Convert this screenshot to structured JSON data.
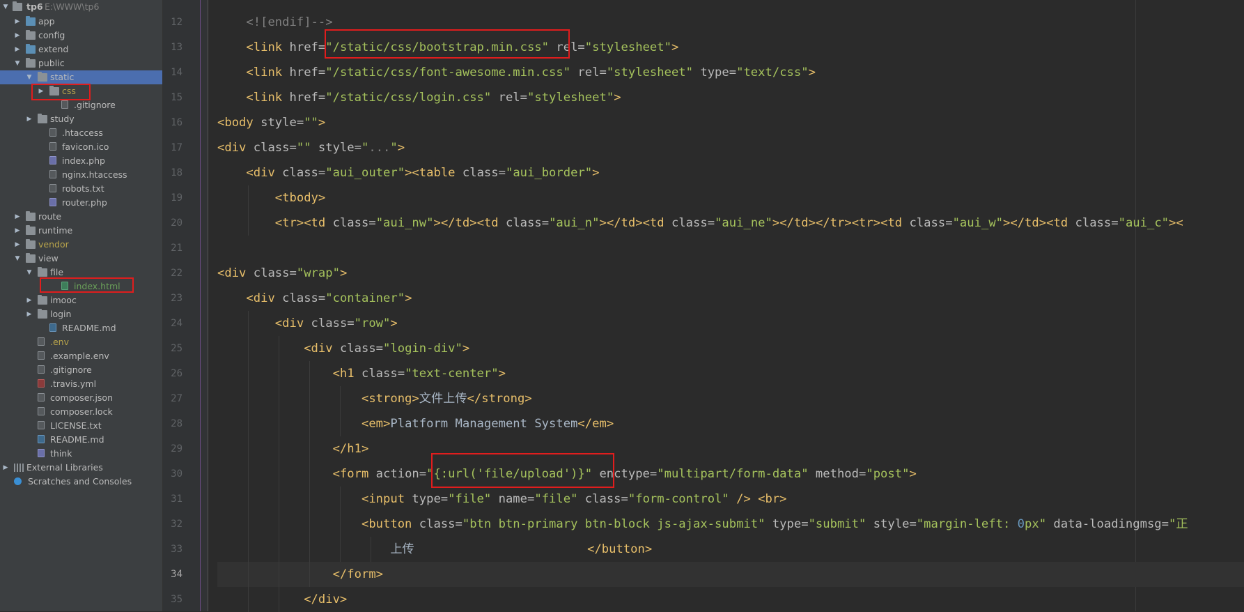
{
  "project": {
    "root": {
      "name": "tp6",
      "path": "E:\\WWW\\tp6"
    },
    "tree": [
      {
        "label": "app",
        "kind": "folder",
        "depth": 1,
        "arrow": "collapsed",
        "color": "blue"
      },
      {
        "label": "config",
        "kind": "folder",
        "depth": 1,
        "arrow": "collapsed"
      },
      {
        "label": "extend",
        "kind": "folder",
        "depth": 1,
        "arrow": "collapsed",
        "color": "blue"
      },
      {
        "label": "public",
        "kind": "folder",
        "depth": 1,
        "arrow": "expanded"
      },
      {
        "label": "static",
        "kind": "folder",
        "depth": 2,
        "arrow": "expanded",
        "selected": true
      },
      {
        "label": "css",
        "kind": "folder",
        "depth": 3,
        "arrow": "collapsed",
        "labelColor": "gold",
        "boxed": true
      },
      {
        "label": ".gitignore",
        "kind": "file",
        "depth": 4,
        "ftype": "cfg"
      },
      {
        "label": "study",
        "kind": "folder",
        "depth": 2,
        "arrow": "collapsed"
      },
      {
        "label": ".htaccess",
        "kind": "file",
        "depth": 3,
        "ftype": "cfg"
      },
      {
        "label": "favicon.ico",
        "kind": "file",
        "depth": 3,
        "ftype": "cfg"
      },
      {
        "label": "index.php",
        "kind": "file",
        "depth": 3,
        "ftype": "php"
      },
      {
        "label": "nginx.htaccess",
        "kind": "file",
        "depth": 3,
        "ftype": "cfg"
      },
      {
        "label": "robots.txt",
        "kind": "file",
        "depth": 3,
        "ftype": "cfg"
      },
      {
        "label": "router.php",
        "kind": "file",
        "depth": 3,
        "ftype": "php"
      },
      {
        "label": "route",
        "kind": "folder",
        "depth": 1,
        "arrow": "collapsed"
      },
      {
        "label": "runtime",
        "kind": "folder",
        "depth": 1,
        "arrow": "collapsed"
      },
      {
        "label": "vendor",
        "kind": "folder",
        "depth": 1,
        "arrow": "collapsed",
        "labelColor": "gold"
      },
      {
        "label": "view",
        "kind": "folder",
        "depth": 1,
        "arrow": "expanded"
      },
      {
        "label": "file",
        "kind": "folder",
        "depth": 2,
        "arrow": "expanded"
      },
      {
        "label": "index.html",
        "kind": "file",
        "depth": 4,
        "ftype": "html",
        "labelColor": "green",
        "boxed": true
      },
      {
        "label": "imooc",
        "kind": "folder",
        "depth": 2,
        "arrow": "collapsed"
      },
      {
        "label": "login",
        "kind": "folder",
        "depth": 2,
        "arrow": "collapsed"
      },
      {
        "label": "README.md",
        "kind": "file",
        "depth": 3,
        "ftype": "md"
      },
      {
        "label": ".env",
        "kind": "file",
        "depth": 2,
        "ftype": "cfg",
        "labelColor": "gold"
      },
      {
        "label": ".example.env",
        "kind": "file",
        "depth": 2,
        "ftype": "cfg"
      },
      {
        "label": ".gitignore",
        "kind": "file",
        "depth": 2,
        "ftype": "cfg"
      },
      {
        "label": ".travis.yml",
        "kind": "file",
        "depth": 2,
        "ftype": "yml"
      },
      {
        "label": "composer.json",
        "kind": "file",
        "depth": 2,
        "ftype": "cfg"
      },
      {
        "label": "composer.lock",
        "kind": "file",
        "depth": 2,
        "ftype": "cfg"
      },
      {
        "label": "LICENSE.txt",
        "kind": "file",
        "depth": 2,
        "ftype": "cfg"
      },
      {
        "label": "README.md",
        "kind": "file",
        "depth": 2,
        "ftype": "md"
      },
      {
        "label": "think",
        "kind": "file",
        "depth": 2,
        "ftype": "php"
      },
      {
        "label": "External Libraries",
        "kind": "lib",
        "depth": 0,
        "arrow": "collapsed"
      },
      {
        "label": "Scratches and Consoles",
        "kind": "scratch",
        "depth": 0
      }
    ]
  },
  "editor": {
    "current_line": 34,
    "lines": [
      {
        "n": "12",
        "tokens": [
          [
            "cm",
            "<![endif]-->"
          ]
        ],
        "indent": 1
      },
      {
        "n": "13",
        "tokens": [
          [
            "tg",
            "<link "
          ],
          [
            "at",
            "href="
          ],
          [
            "vl",
            "\"/static/css/bootstrap.min.css\""
          ],
          [
            "at",
            " rel="
          ],
          [
            "vl",
            "\"stylesheet\""
          ],
          [
            "tg",
            ">"
          ]
        ],
        "indent": 1
      },
      {
        "n": "14",
        "tokens": [
          [
            "tg",
            "<link "
          ],
          [
            "at",
            "href="
          ],
          [
            "vl",
            "\"/static/css/font-awesome.min.css\""
          ],
          [
            "at",
            " rel="
          ],
          [
            "vl",
            "\"stylesheet\""
          ],
          [
            "at",
            " type="
          ],
          [
            "vl",
            "\"text/css\""
          ],
          [
            "tg",
            ">"
          ]
        ],
        "indent": 1
      },
      {
        "n": "15",
        "tokens": [
          [
            "tg",
            "<link "
          ],
          [
            "at",
            "href="
          ],
          [
            "vl",
            "\"/static/css/login.css\""
          ],
          [
            "at",
            " rel="
          ],
          [
            "vl",
            "\"stylesheet\""
          ],
          [
            "tg",
            ">"
          ]
        ],
        "indent": 1
      },
      {
        "n": "16",
        "tokens": [
          [
            "tg",
            "<body "
          ],
          [
            "at",
            "style="
          ],
          [
            "vl",
            "\"\""
          ],
          [
            "tg",
            ">"
          ]
        ],
        "indent": 0
      },
      {
        "n": "17",
        "tokens": [
          [
            "tg",
            "<div "
          ],
          [
            "at",
            "class="
          ],
          [
            "vl",
            "\"\""
          ],
          [
            "at",
            " style="
          ],
          [
            "vl",
            "\""
          ],
          [
            "cm",
            "..."
          ],
          [
            "vl",
            "\""
          ],
          [
            "tg",
            ">"
          ]
        ],
        "indent": 0
      },
      {
        "n": "18",
        "tokens": [
          [
            "tg",
            "<div "
          ],
          [
            "at",
            "class="
          ],
          [
            "vl",
            "\"aui_outer\""
          ],
          [
            "tg",
            "><table "
          ],
          [
            "at",
            "class="
          ],
          [
            "vl",
            "\"aui_border\""
          ],
          [
            "tg",
            ">"
          ]
        ],
        "indent": 1
      },
      {
        "n": "19",
        "tokens": [
          [
            "tg",
            "<tbody>"
          ]
        ],
        "indent": 2
      },
      {
        "n": "20",
        "tokens": [
          [
            "tg",
            "<tr><td "
          ],
          [
            "at",
            "class="
          ],
          [
            "vl",
            "\"aui_nw\""
          ],
          [
            "tg",
            "></td><td "
          ],
          [
            "at",
            "class="
          ],
          [
            "vl",
            "\"aui_n\""
          ],
          [
            "tg",
            "></td><td "
          ],
          [
            "at",
            "class="
          ],
          [
            "vl",
            "\"aui_ne\""
          ],
          [
            "tg",
            "></td></tr><tr><td "
          ],
          [
            "at",
            "class="
          ],
          [
            "vl",
            "\"aui_w\""
          ],
          [
            "tg",
            "></td><td "
          ],
          [
            "at",
            "class="
          ],
          [
            "vl",
            "\"aui_c\""
          ],
          [
            "tg",
            "><"
          ]
        ],
        "indent": 2
      },
      {
        "n": "21",
        "tokens": [],
        "indent": 0
      },
      {
        "n": "22",
        "tokens": [
          [
            "tg",
            "<div "
          ],
          [
            "at",
            "class="
          ],
          [
            "vl",
            "\"wrap\""
          ],
          [
            "tg",
            ">"
          ]
        ],
        "indent": 0
      },
      {
        "n": "23",
        "tokens": [
          [
            "tg",
            "<div "
          ],
          [
            "at",
            "class="
          ],
          [
            "vl",
            "\"container\""
          ],
          [
            "tg",
            ">"
          ]
        ],
        "indent": 1
      },
      {
        "n": "24",
        "tokens": [
          [
            "tg",
            "<div "
          ],
          [
            "at",
            "class="
          ],
          [
            "vl",
            "\"row\""
          ],
          [
            "tg",
            ">"
          ]
        ],
        "indent": 2
      },
      {
        "n": "25",
        "tokens": [
          [
            "tg",
            "<div "
          ],
          [
            "at",
            "class="
          ],
          [
            "vl",
            "\"login-div\""
          ],
          [
            "tg",
            ">"
          ]
        ],
        "indent": 3
      },
      {
        "n": "26",
        "tokens": [
          [
            "tg",
            "<h1 "
          ],
          [
            "at",
            "class="
          ],
          [
            "vl",
            "\"text-center\""
          ],
          [
            "tg",
            ">"
          ]
        ],
        "indent": 4
      },
      {
        "n": "27",
        "tokens": [
          [
            "tg",
            "<strong>"
          ],
          [
            "tx",
            "文件上传"
          ],
          [
            "tg",
            "</strong>"
          ]
        ],
        "indent": 5
      },
      {
        "n": "28",
        "tokens": [
          [
            "tg",
            "<em>"
          ],
          [
            "tx",
            "Platform Management System"
          ],
          [
            "tg",
            "</em>"
          ]
        ],
        "indent": 5
      },
      {
        "n": "29",
        "tokens": [
          [
            "tg",
            "</h1>"
          ]
        ],
        "indent": 4
      },
      {
        "n": "30",
        "tokens": [
          [
            "tg",
            "<form "
          ],
          [
            "at",
            "action="
          ],
          [
            "vl",
            "\"{:url('file/upload')}\""
          ],
          [
            "at",
            " enctype="
          ],
          [
            "vl",
            "\"multipart/form-data\""
          ],
          [
            "at",
            " method="
          ],
          [
            "vl",
            "\"post\""
          ],
          [
            "tg",
            ">"
          ]
        ],
        "indent": 4
      },
      {
        "n": "31",
        "tokens": [
          [
            "tg",
            "<input "
          ],
          [
            "at",
            "type="
          ],
          [
            "vl",
            "\"file\""
          ],
          [
            "at",
            " name="
          ],
          [
            "vl",
            "\"file\""
          ],
          [
            "at",
            " class="
          ],
          [
            "vl",
            "\"form-control\""
          ],
          [
            "tg",
            " /> <br>"
          ]
        ],
        "indent": 5
      },
      {
        "n": "32",
        "tokens": [
          [
            "tg",
            "<button "
          ],
          [
            "at",
            "class="
          ],
          [
            "vl",
            "\"btn btn-primary btn-block js-ajax-submit\""
          ],
          [
            "at",
            " type="
          ],
          [
            "vl",
            "\"submit\""
          ],
          [
            "at",
            " style="
          ],
          [
            "vl",
            "\"margin-left: "
          ],
          [
            "nm",
            "0"
          ],
          [
            "vl",
            "px\""
          ],
          [
            "at",
            " data-loadingmsg="
          ],
          [
            "vl",
            "\"正"
          ]
        ],
        "indent": 5
      },
      {
        "n": "33",
        "tokens": [
          [
            "tx",
            "上传                        "
          ],
          [
            "tg",
            "</button>"
          ]
        ],
        "indent": 6
      },
      {
        "n": "34",
        "tokens": [
          [
            "tg",
            "</form>"
          ]
        ],
        "indent": 4
      },
      {
        "n": "35",
        "tokens": [
          [
            "tg",
            "</div>"
          ]
        ],
        "indent": 3
      }
    ]
  }
}
